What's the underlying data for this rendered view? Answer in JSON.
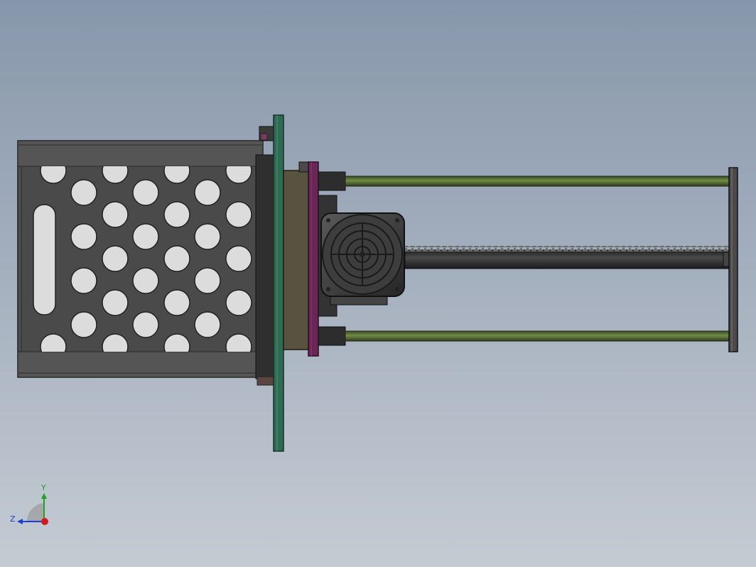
{
  "viewport": {
    "background_top": "#8797ab",
    "background_bottom": "#c4cbd3"
  },
  "triad": {
    "y_label": "Y",
    "z_label": "Z",
    "y_color": "#1fa21f",
    "z_color": "#1b3fd6",
    "x_color": "#d41a1a"
  },
  "colors": {
    "enclosure": "#4f4f4f",
    "enclosure_dark": "#2e2e2e",
    "green_plate": "#2f6b52",
    "olive_block": "#5a5240",
    "magenta_plate": "#6a2656",
    "green_rods": "#56733a",
    "motor": "#3d3d3d",
    "screw": "#2b2b2b"
  }
}
